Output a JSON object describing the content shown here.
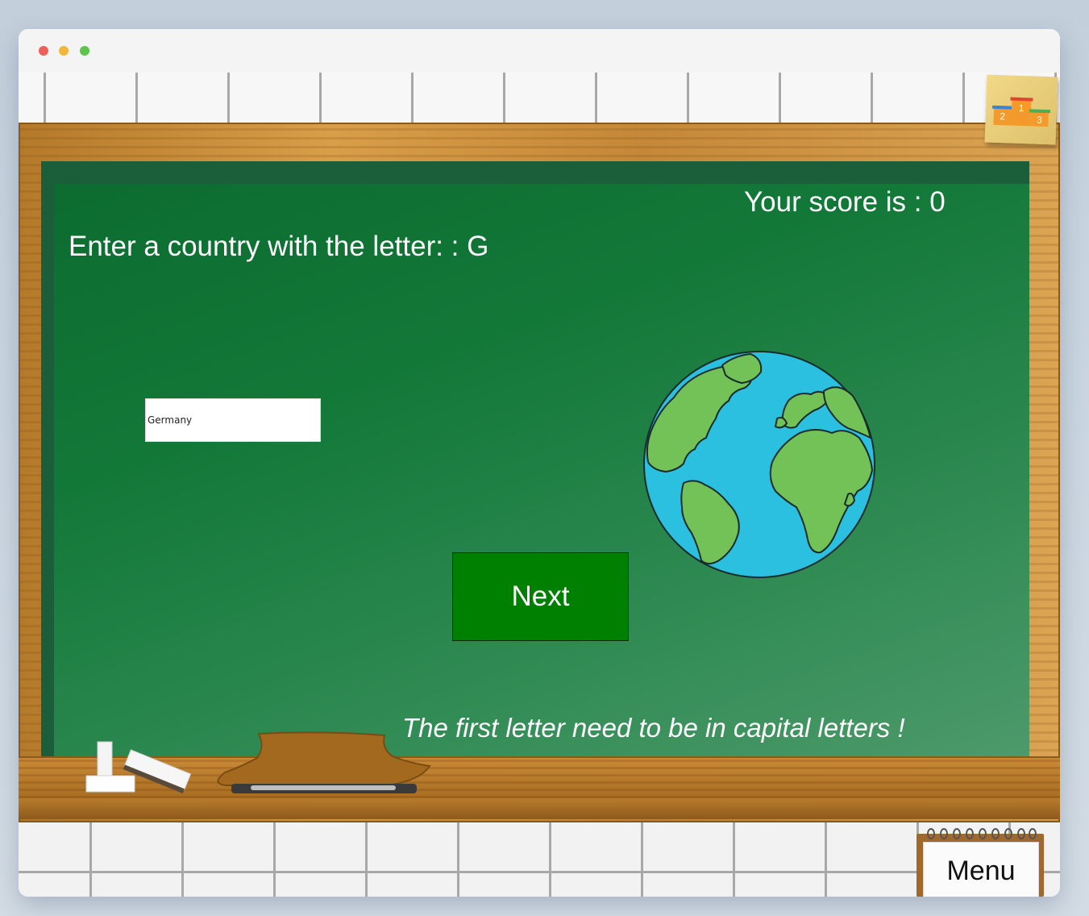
{
  "game": {
    "score_text": "Your score is : 0",
    "prompt_text": "Enter a country with the letter: : G",
    "answer_value": "Germany",
    "next_label": "Next",
    "hint_text": "The first letter need to be in capital letters !",
    "menu_label": "Menu"
  },
  "leaderboard_icon": {
    "name": "podium-icon",
    "places": [
      "1",
      "2",
      "3"
    ]
  },
  "colors": {
    "board": "#127838",
    "next_button": "#008000",
    "frame": "#c88a36",
    "text": "#ffffff",
    "ocean": "#2bbfe0",
    "land": "#72c257"
  }
}
